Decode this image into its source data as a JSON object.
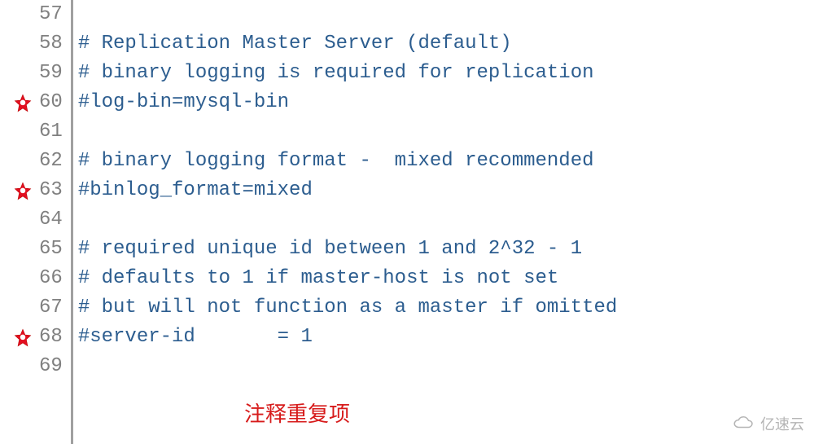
{
  "lines": [
    {
      "num": "57",
      "text": "",
      "star": false
    },
    {
      "num": "58",
      "text": "# Replication Master Server (default)",
      "star": false
    },
    {
      "num": "59",
      "text": "# binary logging is required for replication",
      "star": false
    },
    {
      "num": "60",
      "text": "#log-bin=mysql-bin",
      "star": true
    },
    {
      "num": "61",
      "text": "",
      "star": false
    },
    {
      "num": "62",
      "text": "# binary logging format -  mixed recommended",
      "star": false
    },
    {
      "num": "63",
      "text": "#binlog_format=mixed",
      "star": true
    },
    {
      "num": "64",
      "text": "",
      "star": false
    },
    {
      "num": "65",
      "text": "# required unique id between 1 and 2^32 - 1",
      "star": false
    },
    {
      "num": "66",
      "text": "# defaults to 1 if master-host is not set",
      "star": false
    },
    {
      "num": "67",
      "text": "# but will not function as a master if omitted",
      "star": false
    },
    {
      "num": "68",
      "text": "#server-id       = 1",
      "star": true
    },
    {
      "num": "69",
      "text": "",
      "star": false
    }
  ],
  "caption": "注释重复项",
  "watermark": "亿速云",
  "colors": {
    "comment": "#2c5d8f",
    "line_number": "#808080",
    "star": "#e20f20",
    "caption": "#d71b1b"
  }
}
